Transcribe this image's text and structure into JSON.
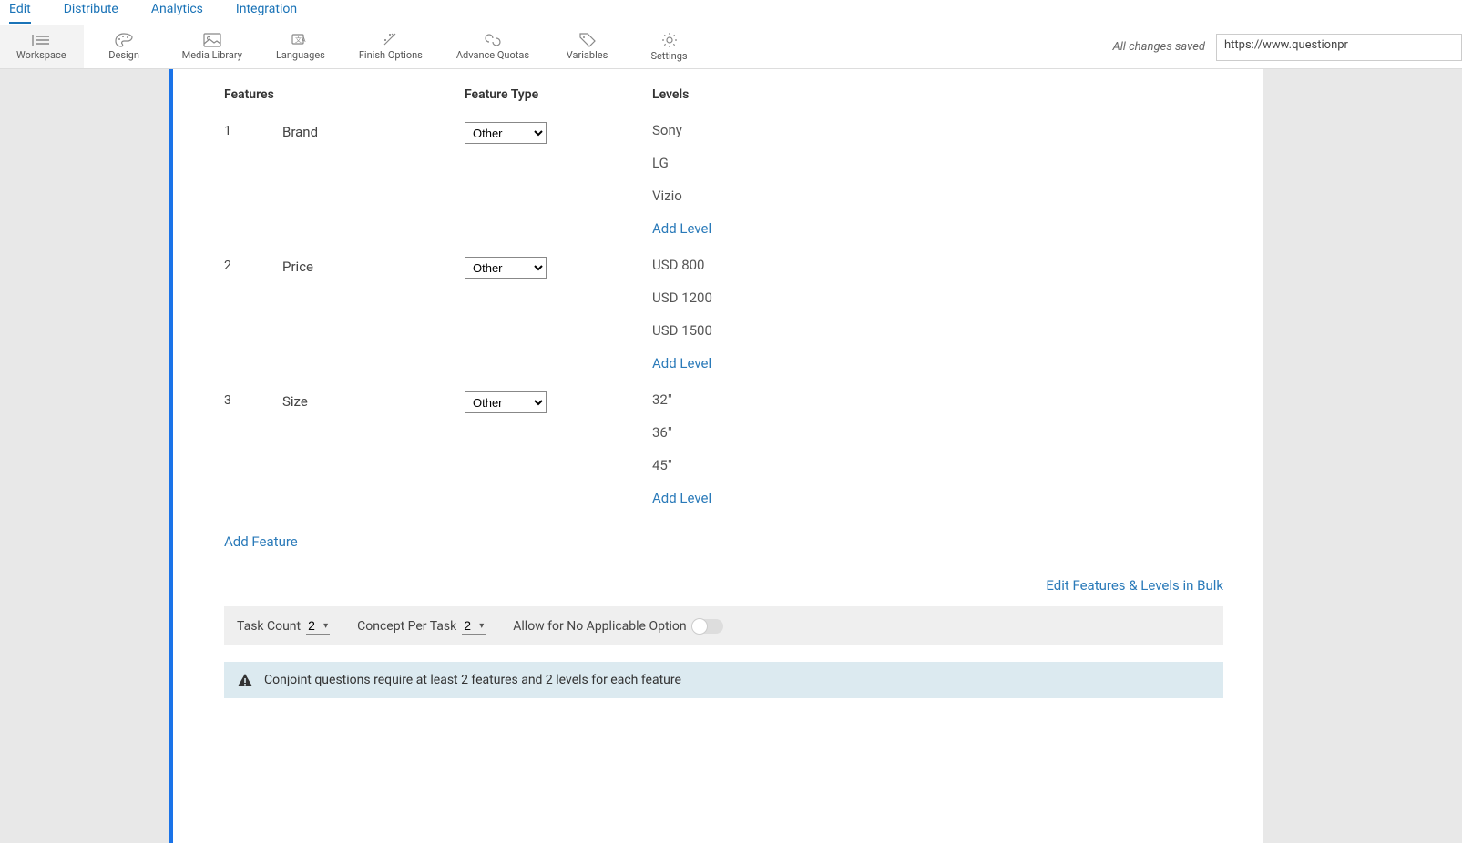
{
  "topTabs": {
    "edit": "Edit",
    "distribute": "Distribute",
    "analytics": "Analytics",
    "integration": "Integration"
  },
  "toolbar": {
    "workspace": "Workspace",
    "design": "Design",
    "mediaLibrary": "Media Library",
    "languages": "Languages",
    "finishOptions": "Finish Options",
    "advanceQuotas": "Advance Quotas",
    "variables": "Variables",
    "settings": "Settings",
    "savedText": "All changes saved",
    "url": "https://www.questionpr"
  },
  "headers": {
    "features": "Features",
    "featureType": "Feature Type",
    "levels": "Levels"
  },
  "featureTypeOptions": [
    "Other"
  ],
  "features": [
    {
      "idx": "1",
      "name": "Brand",
      "type": "Other",
      "levels": [
        "Sony",
        "LG",
        "Vizio"
      ]
    },
    {
      "idx": "2",
      "name": "Price",
      "type": "Other",
      "levels": [
        "USD 800",
        "USD 1200",
        "USD 1500"
      ]
    },
    {
      "idx": "3",
      "name": "Size",
      "type": "Other",
      "levels": [
        "32\"",
        "36\"",
        "45\""
      ]
    }
  ],
  "links": {
    "addLevel": "Add Level",
    "addFeature": "Add Feature",
    "bulk": "Edit Features & Levels in Bulk"
  },
  "config": {
    "taskCountLabel": "Task Count",
    "taskCountValue": "2",
    "conceptLabel": "Concept Per Task",
    "conceptValue": "2",
    "allowNone": "Allow for No Applicable Option"
  },
  "info": {
    "message": "Conjoint questions require at least 2 features and 2 levels for each feature"
  }
}
